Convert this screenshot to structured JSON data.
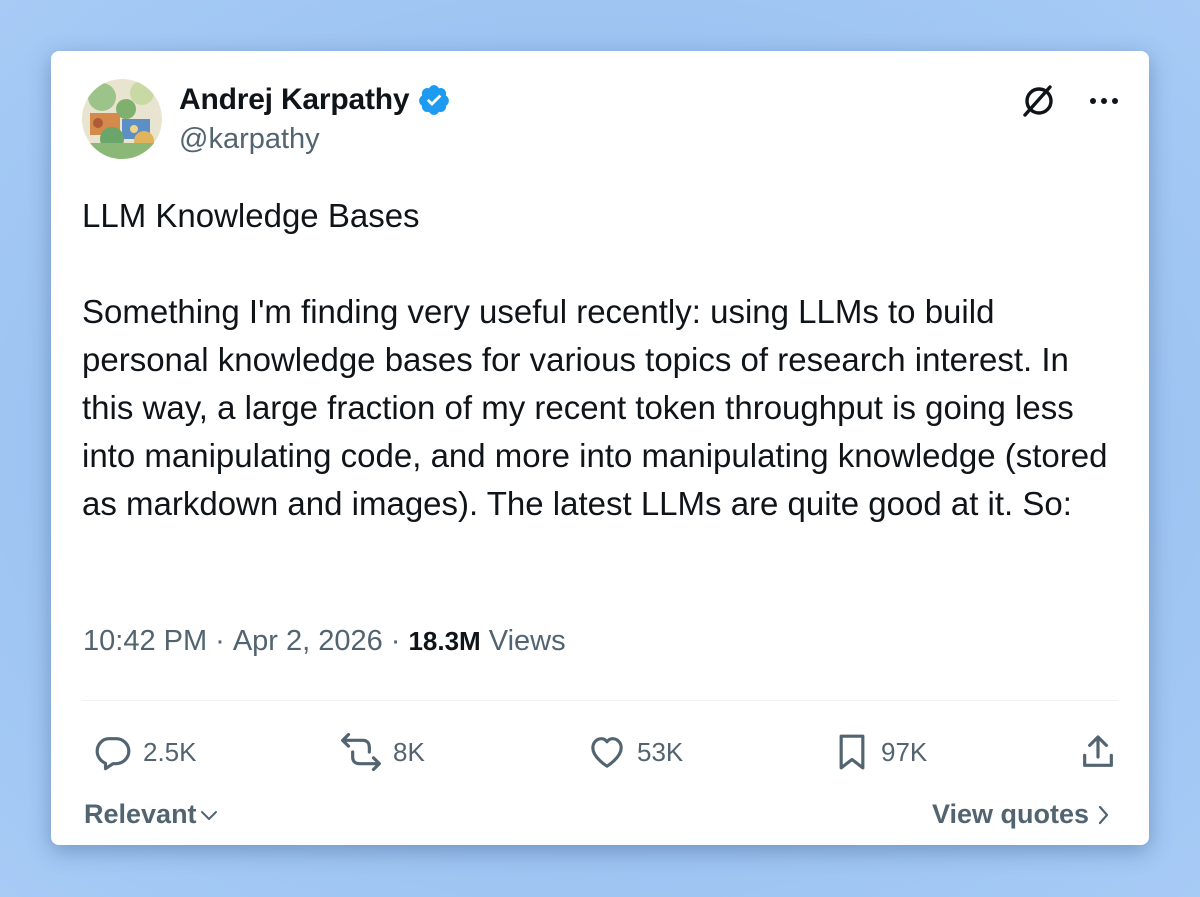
{
  "author": {
    "name": "Andrej Karpathy",
    "handle": "@karpathy",
    "verified": true,
    "avatar_icon": "avatar-illustration"
  },
  "header_icons": {
    "grok": "grok-icon",
    "more": "more-icon"
  },
  "tweet": {
    "title": "LLM Knowledge Bases",
    "body": "Something I'm finding very useful recently: using LLMs to build personal knowledge bases for various topics of research interest. In this way, a large fraction of my recent token throughput is going less into manipulating code, and more into manipulating knowledge (stored as markdown and images). The latest LLMs are quite good at it. So:"
  },
  "meta": {
    "time": "10:42 PM",
    "date": "Apr 2, 2026",
    "separator": "·",
    "views_count": "18.3M",
    "views_label": "Views"
  },
  "actions": {
    "replies": "2.5K",
    "reposts": "8K",
    "likes": "53K",
    "bookmarks": "97K"
  },
  "footer": {
    "sort_label": "Relevant",
    "quotes_label": "View quotes"
  },
  "colors": {
    "accent": "#1d9bf0",
    "text_primary": "#0f1419",
    "text_secondary": "#536471",
    "background": "#9cc3f2"
  }
}
